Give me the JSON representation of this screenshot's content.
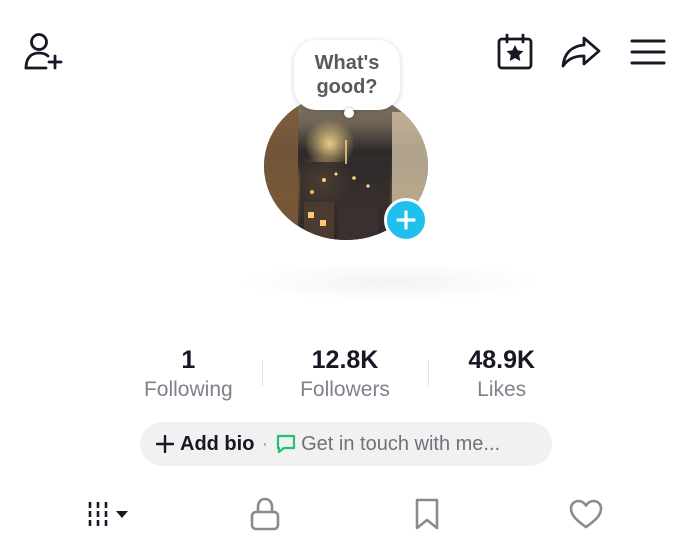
{
  "header": {
    "icons": {
      "add_friend": "person-plus-icon",
      "calendar": "calendar-star-icon",
      "share": "share-arrow-icon",
      "menu": "hamburger-menu-icon"
    }
  },
  "profile": {
    "bubble_line1": "What's",
    "bubble_line2": "good?",
    "add_photo_icon": "plus-icon"
  },
  "stats": [
    {
      "value": "1",
      "label": "Following"
    },
    {
      "value": "12.8K",
      "label": "Followers"
    },
    {
      "value": "48.9K",
      "label": "Likes"
    }
  ],
  "bio": {
    "add_label": "Add bio",
    "separator": "·",
    "contact_label": "Get in touch with me..."
  },
  "tabs": {
    "icons": [
      "grid-dropdown-icon",
      "lock-icon",
      "bookmark-icon",
      "heart-icon"
    ]
  },
  "colors": {
    "accent": "#20c0ee",
    "contact_icon": "#25c26e",
    "text_primary": "#161823",
    "text_secondary": "#80818a",
    "pill_bg": "#f1f1f2"
  }
}
